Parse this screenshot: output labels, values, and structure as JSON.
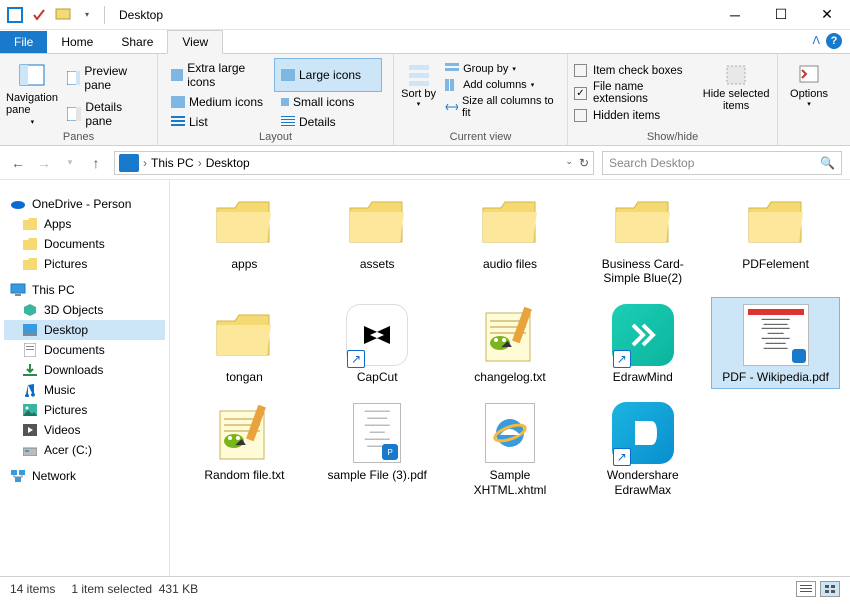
{
  "title": "Desktop",
  "tabs": {
    "file": "File",
    "home": "Home",
    "share": "Share",
    "view": "View"
  },
  "ribbon": {
    "panes": {
      "nav": "Navigation pane",
      "preview": "Preview pane",
      "details": "Details pane",
      "label": "Panes"
    },
    "layout": {
      "extra_large": "Extra large icons",
      "large": "Large icons",
      "medium": "Medium icons",
      "small": "Small icons",
      "list": "List",
      "details": "Details",
      "label": "Layout"
    },
    "sort": {
      "sort_by": "Sort by",
      "group_by": "Group by",
      "add_cols": "Add columns",
      "size_cols": "Size all columns to fit",
      "label": "Current view"
    },
    "showhide": {
      "checkboxes": "Item check boxes",
      "extensions": "File name extensions",
      "hidden": "Hidden items",
      "hide_sel": "Hide selected items",
      "label": "Show/hide"
    },
    "options": "Options"
  },
  "breadcrumb": {
    "root": "This PC",
    "current": "Desktop",
    "search_placeholder": "Search Desktop"
  },
  "sidebar": {
    "onedrive": "OneDrive - Person",
    "apps": "Apps",
    "documents": "Documents",
    "pictures": "Pictures",
    "this_pc": "This PC",
    "objects3d": "3D Objects",
    "desktop": "Desktop",
    "documents2": "Documents",
    "downloads": "Downloads",
    "music": "Music",
    "pictures2": "Pictures",
    "videos": "Videos",
    "acer": "Acer (C:)",
    "network": "Network"
  },
  "files": [
    {
      "name": "apps",
      "type": "folder"
    },
    {
      "name": "assets",
      "type": "folder"
    },
    {
      "name": "audio files",
      "type": "folder"
    },
    {
      "name": "Business Card-Simple Blue(2)",
      "type": "folder"
    },
    {
      "name": "PDFelement",
      "type": "folder"
    },
    {
      "name": "tongan",
      "type": "folder"
    },
    {
      "name": "CapCut",
      "type": "app-capcut"
    },
    {
      "name": "changelog.txt",
      "type": "notepadpp"
    },
    {
      "name": "EdrawMind",
      "type": "app-edrawmind"
    },
    {
      "name": "PDF - Wikipedia.pdf",
      "type": "pdf",
      "selected": true
    },
    {
      "name": "Random file.txt",
      "type": "notepadpp"
    },
    {
      "name": "sample File (3).pdf",
      "type": "pdf-doc"
    },
    {
      "name": "Sample XHTML.xhtml",
      "type": "ie"
    },
    {
      "name": "Wondershare EdrawMax",
      "type": "app-edrawmax"
    }
  ],
  "status": {
    "count": "14 items",
    "selection": "1 item selected",
    "size": "431 KB"
  }
}
